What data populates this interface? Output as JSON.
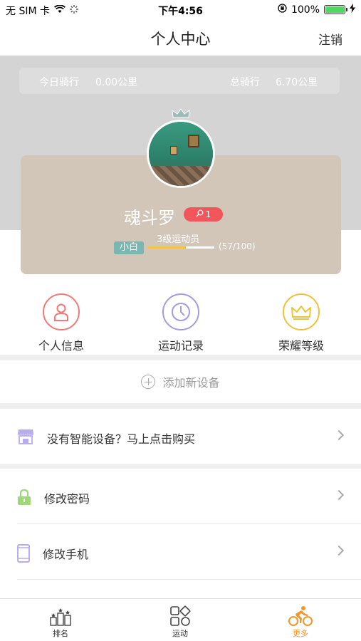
{
  "status_bar": {
    "carrier": "无 SIM 卡",
    "time": "下午4:56",
    "battery": "100%"
  },
  "navbar": {
    "title": "个人中心",
    "logout": "注销"
  },
  "stats": {
    "today_label": "今日骑行",
    "today_value": "0.00公里",
    "total_label": "总骑行",
    "total_value": "6.70公里"
  },
  "profile": {
    "username": "魂斗罗",
    "badge_count": "1",
    "level_label": "3级运动员",
    "tag": "小白",
    "progress_text": "(57/100)",
    "progress_fraction": 0.57
  },
  "quick_actions": [
    {
      "label": "个人信息",
      "color": "#f07a7a"
    },
    {
      "label": "运动记录",
      "color": "#a79ae0"
    },
    {
      "label": "荣耀等级",
      "color": "#f0c23a"
    }
  ],
  "add_device": "添加新设备",
  "menu": {
    "buy": "没有智能设备？马上点击购买",
    "change_password": "修改密码",
    "change_phone": "修改手机"
  },
  "tabs": [
    {
      "label": "排名"
    },
    {
      "label": "运动"
    },
    {
      "label": "更多"
    }
  ],
  "colors": {
    "accent": "#f0972c",
    "badge": "#f2555a",
    "card": "#d1c6b8",
    "progress": "#f5c34a",
    "tag": "#7ab7b3"
  }
}
